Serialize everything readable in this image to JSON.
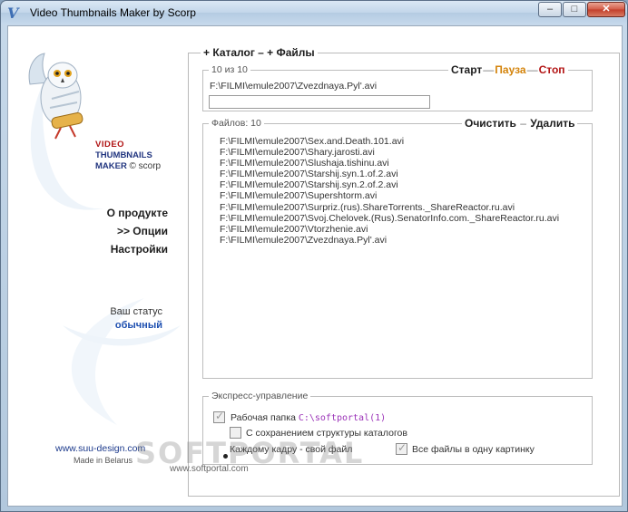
{
  "window": {
    "title": "Video Thumbnails Maker by Scorp",
    "icon": "V",
    "controls": {
      "minimize": "–",
      "maximize": "□",
      "close": "✕"
    }
  },
  "sidebar": {
    "logo": {
      "line1": "VIDEO",
      "line2": "THUMBNAILS",
      "line3": "MAKER",
      "copyright": "© scorp"
    },
    "nav": [
      {
        "label": "О продукте"
      },
      {
        "label": ">> Опции"
      },
      {
        "label": "Настройки"
      }
    ],
    "status": {
      "label": "Ваш статус",
      "value": "обычный"
    },
    "site": "www.suu-design.com",
    "made_in": "Made in Belarus"
  },
  "main": {
    "legend": "+ Каталог – + Файлы",
    "progress_group": {
      "counter": "10 из 10",
      "actions": {
        "start": "Старт",
        "pause": "Пауза",
        "stop": "Стоп"
      },
      "current_file": "F:\\FILMI\\emule2007\\Zvezdnaya.Pyl'.avi",
      "progress_fraction": 0.0
    },
    "files_group": {
      "label": "Файлов: 10",
      "actions": {
        "clear": "Очистить",
        "delete": "Удалить"
      },
      "files": [
        "F:\\FILMI\\emule2007\\Sex.and.Death.101.avi",
        "F:\\FILMI\\emule2007\\Shary.jarosti.avi",
        "F:\\FILMI\\emule2007\\Slushaja.tishinu.avi",
        "F:\\FILMI\\emule2007\\Starshij.syn.1.of.2.avi",
        "F:\\FILMI\\emule2007\\Starshij.syn.2.of.2.avi",
        "F:\\FILMI\\emule2007\\Supershtorm.avi",
        "F:\\FILMI\\emule2007\\Surpriz.(rus).ShareTorrents._ShareReactor.ru.avi",
        "F:\\FILMI\\emule2007\\Svoj.Chelovek.(Rus).SenatorInfo.com._ShareReactor.ru.avi",
        "F:\\FILMI\\emule2007\\Vtorzhenie.avi",
        "F:\\FILMI\\emule2007\\Zvezdnaya.Pyl'.avi"
      ]
    },
    "express": {
      "legend": "Экспресс-управление",
      "work_folder": {
        "label": "Рабочая папка",
        "value": "C:\\softportal(1)",
        "checked": true
      },
      "keep_structure": {
        "label": "С сохранением структуры каталогов",
        "checked": false
      },
      "per_frame": {
        "label": "Каждому кадру - свой файл"
      },
      "all_in_one": {
        "label": "Все файлы в одну картинку",
        "checked": true
      }
    }
  },
  "watermark": {
    "text": "SOFTPORTAL",
    "url": "www.softportal.com"
  }
}
